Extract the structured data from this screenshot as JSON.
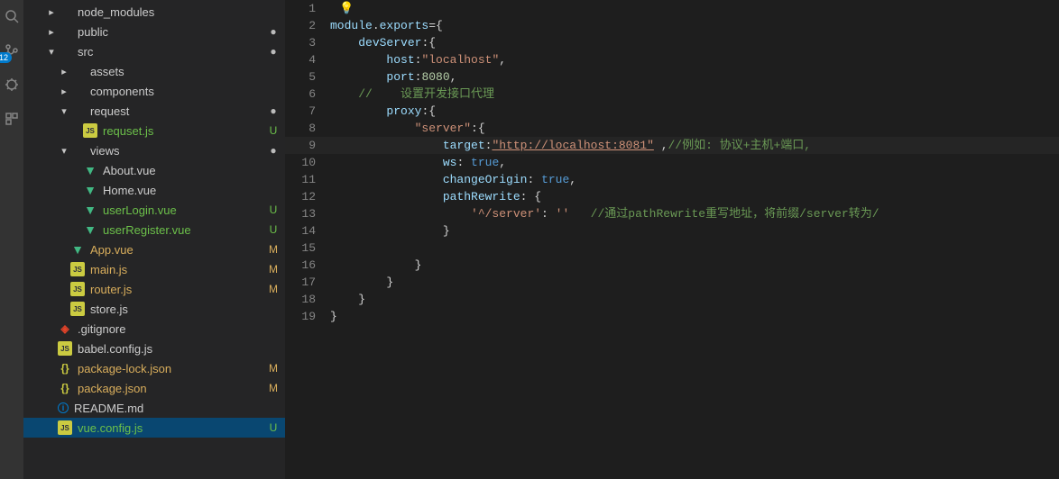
{
  "activity": {
    "badge": "12"
  },
  "explorer": {
    "items": [
      {
        "indent": 1,
        "chevron": "right",
        "icon": "folder",
        "label": "node_modules"
      },
      {
        "indent": 1,
        "chevron": "right",
        "icon": "folder",
        "label": "public",
        "status": "dot"
      },
      {
        "indent": 1,
        "chevron": "down",
        "icon": "folder",
        "label": "src",
        "status": "dot"
      },
      {
        "indent": 2,
        "chevron": "right",
        "icon": "folder",
        "label": "assets"
      },
      {
        "indent": 2,
        "chevron": "right",
        "icon": "folder",
        "label": "components"
      },
      {
        "indent": 2,
        "chevron": "down",
        "icon": "folder",
        "label": "request",
        "status": "dot"
      },
      {
        "indent": 3,
        "chevron": "none",
        "icon": "js",
        "label": "requset.js",
        "status": "U"
      },
      {
        "indent": 2,
        "chevron": "down",
        "icon": "folder",
        "label": "views",
        "status": "dot"
      },
      {
        "indent": 3,
        "chevron": "none",
        "icon": "vue",
        "label": "About.vue"
      },
      {
        "indent": 3,
        "chevron": "none",
        "icon": "vue",
        "label": "Home.vue"
      },
      {
        "indent": 3,
        "chevron": "none",
        "icon": "vue",
        "label": "userLogin.vue",
        "status": "U"
      },
      {
        "indent": 3,
        "chevron": "none",
        "icon": "vue",
        "label": "userRegister.vue",
        "status": "U"
      },
      {
        "indent": 2,
        "chevron": "none",
        "icon": "vue",
        "label": "App.vue",
        "status": "M"
      },
      {
        "indent": 2,
        "chevron": "none",
        "icon": "js",
        "label": "main.js",
        "status": "M"
      },
      {
        "indent": 2,
        "chevron": "none",
        "icon": "js",
        "label": "router.js",
        "status": "M"
      },
      {
        "indent": 2,
        "chevron": "none",
        "icon": "js",
        "label": "store.js"
      },
      {
        "indent": 1,
        "chevron": "none",
        "icon": "git",
        "label": ".gitignore"
      },
      {
        "indent": 1,
        "chevron": "none",
        "icon": "js",
        "label": "babel.config.js"
      },
      {
        "indent": 1,
        "chevron": "none",
        "icon": "json",
        "label": "package-lock.json",
        "status": "M"
      },
      {
        "indent": 1,
        "chevron": "none",
        "icon": "json",
        "label": "package.json",
        "status": "M"
      },
      {
        "indent": 1,
        "chevron": "none",
        "icon": "info",
        "label": "README.md"
      },
      {
        "indent": 1,
        "chevron": "none",
        "icon": "js",
        "label": "vue.config.js",
        "status": "U",
        "selected": true
      }
    ]
  },
  "editor": {
    "lines": [
      {
        "num": 1,
        "bulb": true
      },
      {
        "num": 2,
        "tokens": [
          [
            "punct",
            ""
          ],
          [
            "keyword",
            "module"
          ],
          [
            "punct",
            "."
          ],
          [
            "property",
            "exports"
          ],
          [
            "punct",
            "={"
          ]
        ]
      },
      {
        "num": 3,
        "tokens": [
          [
            "punct",
            "    "
          ],
          [
            "property",
            "devServer"
          ],
          [
            "punct",
            ":{"
          ]
        ]
      },
      {
        "num": 4,
        "tokens": [
          [
            "punct",
            "        "
          ],
          [
            "property",
            "host"
          ],
          [
            "punct",
            ":"
          ],
          [
            "string",
            "\"localhost\""
          ],
          [
            "punct",
            ","
          ]
        ]
      },
      {
        "num": 5,
        "tokens": [
          [
            "punct",
            "        "
          ],
          [
            "property",
            "port"
          ],
          [
            "punct",
            ":"
          ],
          [
            "number",
            "8080"
          ],
          [
            "punct",
            ","
          ]
        ]
      },
      {
        "num": 6,
        "tokens": [
          [
            "punct",
            "    "
          ],
          [
            "comment",
            "//    设置开发接口代理"
          ]
        ]
      },
      {
        "num": 7,
        "tokens": [
          [
            "punct",
            "        "
          ],
          [
            "property",
            "proxy"
          ],
          [
            "punct",
            ":{"
          ]
        ]
      },
      {
        "num": 8,
        "tokens": [
          [
            "punct",
            "            "
          ],
          [
            "string",
            "\"server\""
          ],
          [
            "punct",
            ":{"
          ]
        ]
      },
      {
        "num": 9,
        "hl": true,
        "tokens": [
          [
            "punct",
            "                "
          ],
          [
            "property",
            "target"
          ],
          [
            "punct",
            ":"
          ],
          [
            "string-u",
            "\"http://localhost:8081\""
          ],
          [
            "punct",
            " ,"
          ],
          [
            "comment",
            "//例如: 协议+主机+端口,"
          ]
        ]
      },
      {
        "num": 10,
        "tokens": [
          [
            "punct",
            "                "
          ],
          [
            "property",
            "ws"
          ],
          [
            "punct",
            ": "
          ],
          [
            "true",
            "true"
          ],
          [
            "punct",
            ","
          ]
        ]
      },
      {
        "num": 11,
        "tokens": [
          [
            "punct",
            "                "
          ],
          [
            "property",
            "changeOrigin"
          ],
          [
            "punct",
            ": "
          ],
          [
            "true",
            "true"
          ],
          [
            "punct",
            ","
          ]
        ]
      },
      {
        "num": 12,
        "tokens": [
          [
            "punct",
            "                "
          ],
          [
            "property",
            "pathRewrite"
          ],
          [
            "punct",
            ": {"
          ]
        ]
      },
      {
        "num": 13,
        "tokens": [
          [
            "punct",
            "                    "
          ],
          [
            "string",
            "'^/server'"
          ],
          [
            "punct",
            ": "
          ],
          [
            "string",
            "''"
          ],
          [
            "punct",
            "   "
          ],
          [
            "comment",
            "//通过pathRewrite重写地址，将前缀/server转为/"
          ]
        ]
      },
      {
        "num": 14,
        "tokens": [
          [
            "punct",
            "                }"
          ]
        ]
      },
      {
        "num": 15,
        "tokens": [
          [
            "punct",
            ""
          ]
        ]
      },
      {
        "num": 16,
        "tokens": [
          [
            "punct",
            "            }"
          ]
        ]
      },
      {
        "num": 17,
        "tokens": [
          [
            "punct",
            "        }"
          ]
        ]
      },
      {
        "num": 18,
        "tokens": [
          [
            "punct",
            "    }"
          ]
        ]
      },
      {
        "num": 19,
        "tokens": [
          [
            "punct",
            "}"
          ]
        ]
      }
    ]
  }
}
